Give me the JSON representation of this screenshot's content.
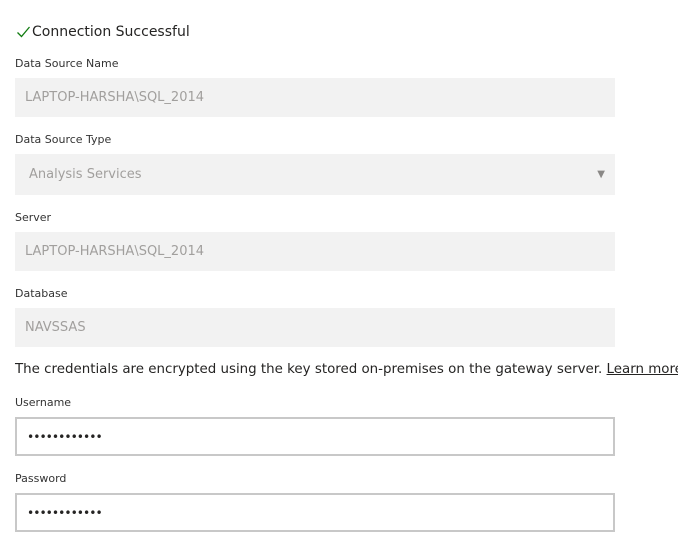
{
  "status": {
    "icon": "checkmark-icon",
    "text": "Connection Successful",
    "color": "#107c10"
  },
  "fields": {
    "data_source_name": {
      "label": "Data Source Name",
      "value": "LAPTOP-HARSHA\\SQL_2014"
    },
    "data_source_type": {
      "label": "Data Source Type",
      "value": "Analysis Services",
      "icon": "chevron-down-icon"
    },
    "server": {
      "label": "Server",
      "value": "LAPTOP-HARSHA\\SQL_2014"
    },
    "database": {
      "label": "Database",
      "value": "NAVSSAS"
    }
  },
  "credentials": {
    "note": "The credentials are encrypted using the key stored on-premises on the gateway server.",
    "link": "Learn more",
    "username": {
      "label": "Username",
      "value": "••••••••••••"
    },
    "password": {
      "label": "Password",
      "value": "••••••••••••"
    }
  }
}
